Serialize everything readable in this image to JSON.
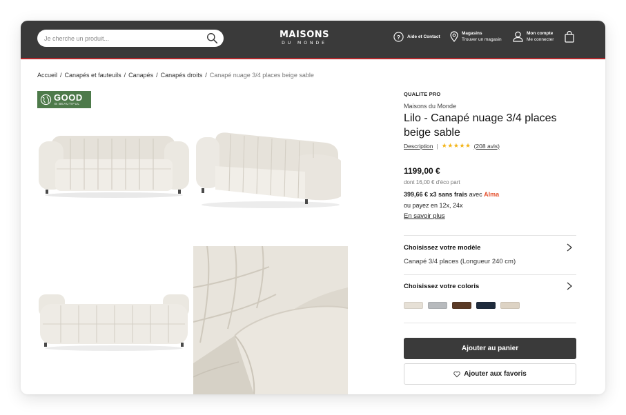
{
  "header": {
    "search_placeholder": "Je cherche un produit...",
    "logo_line1": "MAISONS",
    "logo_line2": "DU MONDE",
    "help_label": "Aide et Contact",
    "stores_label": "Magasins",
    "stores_sub": "Trouver un magasin",
    "account_label": "Mon compte",
    "account_sub": "Me connecter",
    "accent_color": "#b0282c"
  },
  "breadcrumb": {
    "items": [
      "Accueil",
      "Canapés et fauteuils",
      "Canapés",
      "Canapés droits"
    ],
    "current": "Canapé nuage 3/4 places beige sable"
  },
  "badge": {
    "line1": "GOOD",
    "line2": "IS BEAUTIFUL"
  },
  "gallery": {
    "images": [
      "sofa-front-view",
      "sofa-three-quarter-view",
      "sofa-back-view",
      "sofa-fabric-closeup"
    ]
  },
  "product": {
    "quality": "QUALITE PRO",
    "brand": "Maisons du Monde",
    "title": "Lilo - Canapé nuage 3/4 places beige sable",
    "description_link": "Description",
    "separator": "|",
    "rating_stars": "★★★★★",
    "rating": 4.5,
    "reviews": "(208 avis)",
    "price": "1199,00 €",
    "eco_part": "dont 16,00 € d'éco part",
    "installment_bold": "399,66 € x3 sans frais",
    "installment_with": "avec",
    "installment_brand": "Alma",
    "pay_more": "ou payez en 12x, 24x",
    "learn_more": "En savoir plus"
  },
  "options": {
    "model_title": "Choisissez votre modèle",
    "model_value": "Canapé 3/4 places (Longueur 240 cm)",
    "color_title": "Choisissez votre coloris",
    "swatches": [
      "#e6e0d6",
      "#b7babd",
      "#5a3a26",
      "#1f2b3c",
      "#ddd3c4"
    ]
  },
  "actions": {
    "add_to_cart": "Ajouter au panier",
    "add_to_favorites": "Ajouter aux favoris"
  }
}
